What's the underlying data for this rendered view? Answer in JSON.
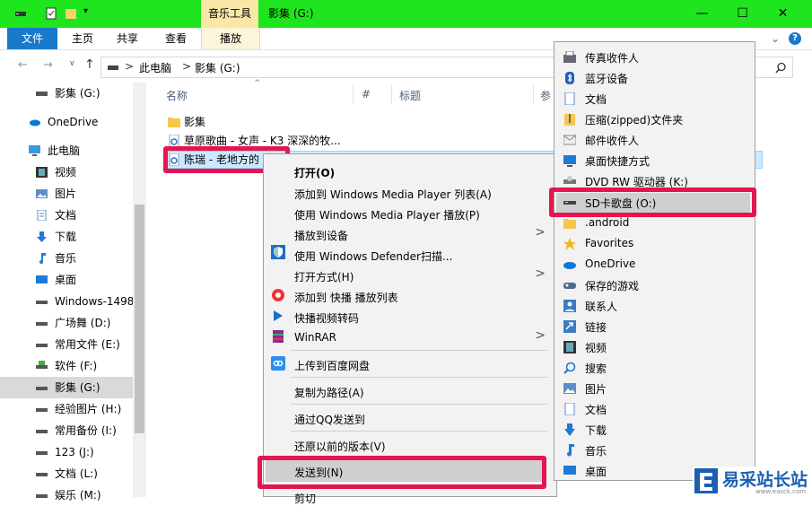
{
  "titlebar": {
    "contextual_tab": "音乐工具",
    "window_title": "影集 (G:)",
    "minimize": "—",
    "maximize": "☐",
    "close": "✕"
  },
  "ribbon": {
    "tabs": [
      "文件",
      "主页",
      "共享",
      "查看",
      "播放"
    ],
    "collapse": "⌄",
    "help": "?"
  },
  "address": {
    "path": [
      "此电脑",
      "影集 (G:)"
    ],
    "separator": ">",
    "search_icon": "search-icon"
  },
  "nav": {
    "items": [
      {
        "label": "影集 (G:)",
        "icon": "drive-icon"
      },
      {
        "label": "OneDrive",
        "icon": "cloud-icon"
      },
      {
        "label": "此电脑",
        "icon": "computer-icon"
      },
      {
        "label": "视频",
        "icon": "video-icon"
      },
      {
        "label": "图片",
        "icon": "pictures-icon"
      },
      {
        "label": "文档",
        "icon": "document-icon"
      },
      {
        "label": "下载",
        "icon": "download-icon"
      },
      {
        "label": "音乐",
        "icon": "music-icon"
      },
      {
        "label": "桌面",
        "icon": "desktop-icon"
      },
      {
        "label": "Windows-1498",
        "icon": "drive-icon"
      },
      {
        "label": "广场舞 (D:)",
        "icon": "drive-icon"
      },
      {
        "label": "常用文件 (E:)",
        "icon": "drive-icon"
      },
      {
        "label": "软件  (F:)",
        "icon": "drive-icon"
      },
      {
        "label": "影集 (G:)",
        "icon": "drive-icon"
      },
      {
        "label": "经验图片 (H:)",
        "icon": "drive-icon"
      },
      {
        "label": "常用备份 (I:)",
        "icon": "drive-icon"
      },
      {
        "label": "123 (J:)",
        "icon": "drive-icon"
      },
      {
        "label": "文档 (L:)",
        "icon": "drive-icon"
      },
      {
        "label": "娱乐 (M:)",
        "icon": "drive-icon"
      }
    ]
  },
  "filelist": {
    "columns": [
      "名称",
      "#",
      "标题",
      "参"
    ],
    "rows": [
      {
        "name": "影集",
        "icon": "folder-icon"
      },
      {
        "name": "草原歌曲 - 女声 - K3 深深的牧...",
        "icon": "audio-file-icon"
      },
      {
        "name": "陈瑞 - 老地方的",
        "icon": "audio-file-icon"
      }
    ]
  },
  "context_menu": {
    "items": [
      {
        "label": "打开(O)",
        "bold": true
      },
      {
        "label": "添加到 Windows Media Player 列表(A)"
      },
      {
        "label": "使用 Windows Media Player 播放(P)"
      },
      {
        "label": "播放到设备",
        "submenu": true
      },
      {
        "label": "使用 Windows Defender扫描...",
        "icon": "defender-icon"
      },
      {
        "label": "打开方式(H)",
        "submenu": true
      },
      {
        "label": "添加到 快播 播放列表",
        "icon": "qvod-icon"
      },
      {
        "label": "快播视频转码",
        "icon": "qvod-convert-icon"
      },
      {
        "label": "WinRAR",
        "icon": "winrar-icon",
        "submenu": true
      },
      {
        "label": "上传到百度网盘",
        "icon": "baidu-cloud-icon"
      },
      {
        "label": "复制为路径(A)"
      },
      {
        "label": "通过QQ发送到"
      },
      {
        "label": "还原以前的版本(V)"
      },
      {
        "label": "发送到(N)",
        "submenu": true
      },
      {
        "label": "剪切"
      }
    ]
  },
  "send_to_menu": {
    "items": [
      {
        "label": "传真收件人",
        "icon": "fax-icon"
      },
      {
        "label": "蓝牙设备",
        "icon": "bluetooth-icon"
      },
      {
        "label": "文档",
        "icon": "document-icon"
      },
      {
        "label": "压缩(zipped)文件夹",
        "icon": "zip-folder-icon"
      },
      {
        "label": "邮件收件人",
        "icon": "mail-icon"
      },
      {
        "label": "桌面快捷方式",
        "icon": "desktop-shortcut-icon"
      },
      {
        "label": "DVD RW 驱动器 (K:)",
        "icon": "dvd-drive-icon"
      },
      {
        "label": "SD卡歌盘 (O:)",
        "icon": "sd-card-icon"
      },
      {
        "label": ".android",
        "icon": "folder-icon"
      },
      {
        "label": "Favorites",
        "icon": "star-icon"
      },
      {
        "label": "OneDrive",
        "icon": "cloud-icon"
      },
      {
        "label": "保存的游戏",
        "icon": "games-icon"
      },
      {
        "label": "联系人",
        "icon": "contacts-icon"
      },
      {
        "label": "链接",
        "icon": "links-icon"
      },
      {
        "label": "视频",
        "icon": "video-icon"
      },
      {
        "label": "搜索",
        "icon": "search-icon"
      },
      {
        "label": "图片",
        "icon": "pictures-icon"
      },
      {
        "label": "文档",
        "icon": "document-icon"
      },
      {
        "label": "下载",
        "icon": "download-icon"
      },
      {
        "label": "音乐",
        "icon": "music-icon"
      },
      {
        "label": "桌面",
        "icon": "desktop-icon"
      }
    ]
  },
  "watermark": {
    "brand": "易采站长站",
    "url": "www.easck.com"
  },
  "colors": {
    "titlebar": "#1ee51e",
    "file_tab": "#1979ca",
    "highlight": "#e4154f",
    "contextual": "#f8e7a6"
  }
}
